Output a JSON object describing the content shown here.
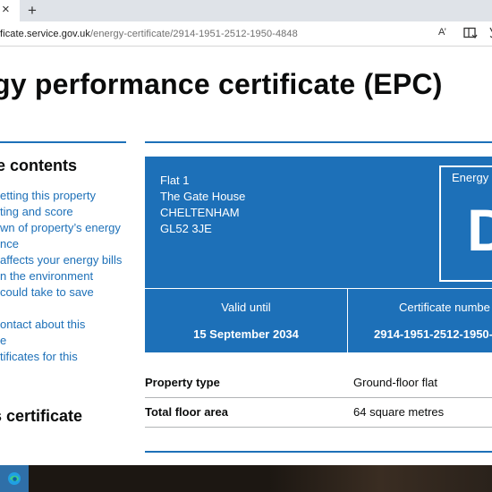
{
  "browser": {
    "tab_close_glyph": "×",
    "new_tab_glyph": "+",
    "url_host": "ficate.service.gov.uk",
    "url_path": "/energy-certificate/2914-1951-2512-1950-4848",
    "read_aloud_glyph": "A’"
  },
  "page": {
    "title": "gy performance certificate (EPC)",
    "toc": {
      "heading": "e contents",
      "items": [
        "etting this property",
        "ting and score",
        "wn of property’s energy",
        "nce",
        "affects your energy bills",
        "n the environment",
        "could take to save",
        "",
        "ontact about this",
        "e",
        "tificates for this"
      ]
    },
    "share_heading": "s certificate",
    "epc": {
      "address_lines": [
        "Flat 1",
        "The Gate House",
        "CHELTENHAM",
        "GL52 3JE"
      ],
      "rating_label": "Energy",
      "rating_letter": "D",
      "valid_until_label": "Valid until",
      "valid_until_value": "15 September 2034",
      "certificate_number_label": "Certificate numbe",
      "certificate_number_value": "2914-1951-2512-1950-"
    },
    "summary": [
      {
        "key": "Property type",
        "value": "Ground-floor flat"
      },
      {
        "key": "Total floor area",
        "value": "64 square metres"
      }
    ]
  },
  "colors": {
    "gov_blue": "#1d70b8",
    "text": "#0b0c0c",
    "taskbar": "#1c1712",
    "edge_button": "#2f6fa8"
  }
}
